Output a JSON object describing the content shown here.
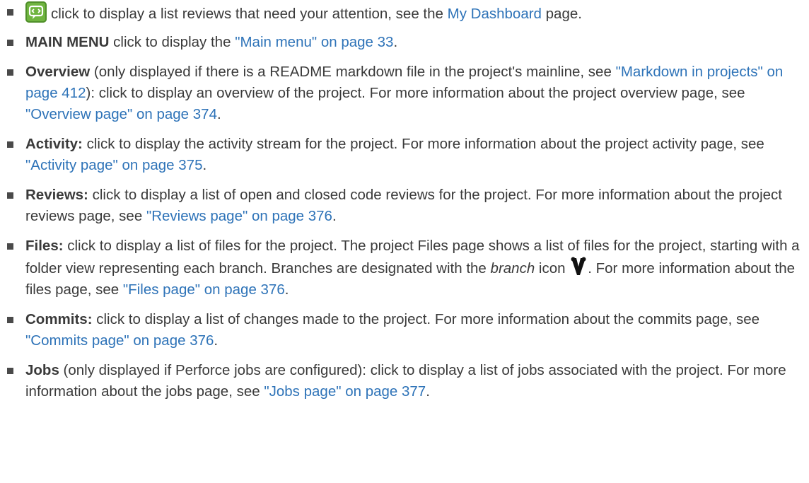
{
  "items": [
    {
      "icon": "dashboard-icon",
      "text1": "click to display a list reviews that need your attention, see the ",
      "link": "My Dashboard",
      "text2": " page."
    },
    {
      "term": "MAIN MENU",
      "text1": " click to display the ",
      "link": "\"Main menu\" on page 33",
      "text2": "."
    },
    {
      "term": "Overview",
      "text1": " (only displayed if there is a README markdown file in the project's mainline, see ",
      "link1": "\"Markdown in projects\" on page 412",
      "text2": "): click to display an overview of the project. For more information about the project overview page, see ",
      "link2": "\"Overview page\" on page 374",
      "text3": "."
    },
    {
      "term": "Activity:",
      "text1": " click to display the activity stream for the project. For more information about the project activity page, see ",
      "link": "\"Activity page\" on page 375",
      "text2": "."
    },
    {
      "term": "Reviews:",
      "text1": " click to display a list of open and closed code reviews for the project. For more information about the project reviews page, see ",
      "link": "\"Reviews page\" on page 376",
      "text2": "."
    },
    {
      "term": "Files:",
      "text1": " click to display a list of files for the project. The project Files page shows a list of files for the project, starting with a folder view representing each branch. Branches are designated with the ",
      "italic": "branch",
      "text2": " icon ",
      "icon": "branch-icon",
      "text3": ". For more information about the files page, see ",
      "link": "\"Files page\" on page 376",
      "text4": "."
    },
    {
      "term": "Commits:",
      "text1": " click to display a list of changes made to the project. For more information about the commits page, see ",
      "link": "\"Commits page\" on page 376",
      "text2": "."
    },
    {
      "term": "Jobs",
      "text1": " (only displayed if Perforce jobs are configured): click to display a list of jobs associated with the project. For more information about the jobs page, see ",
      "link": "\"Jobs page\" on page 377",
      "text2": "."
    }
  ],
  "colors": {
    "link": "#2e73b8",
    "text": "#3a3a3a",
    "icon_green": "#6fb43f"
  }
}
